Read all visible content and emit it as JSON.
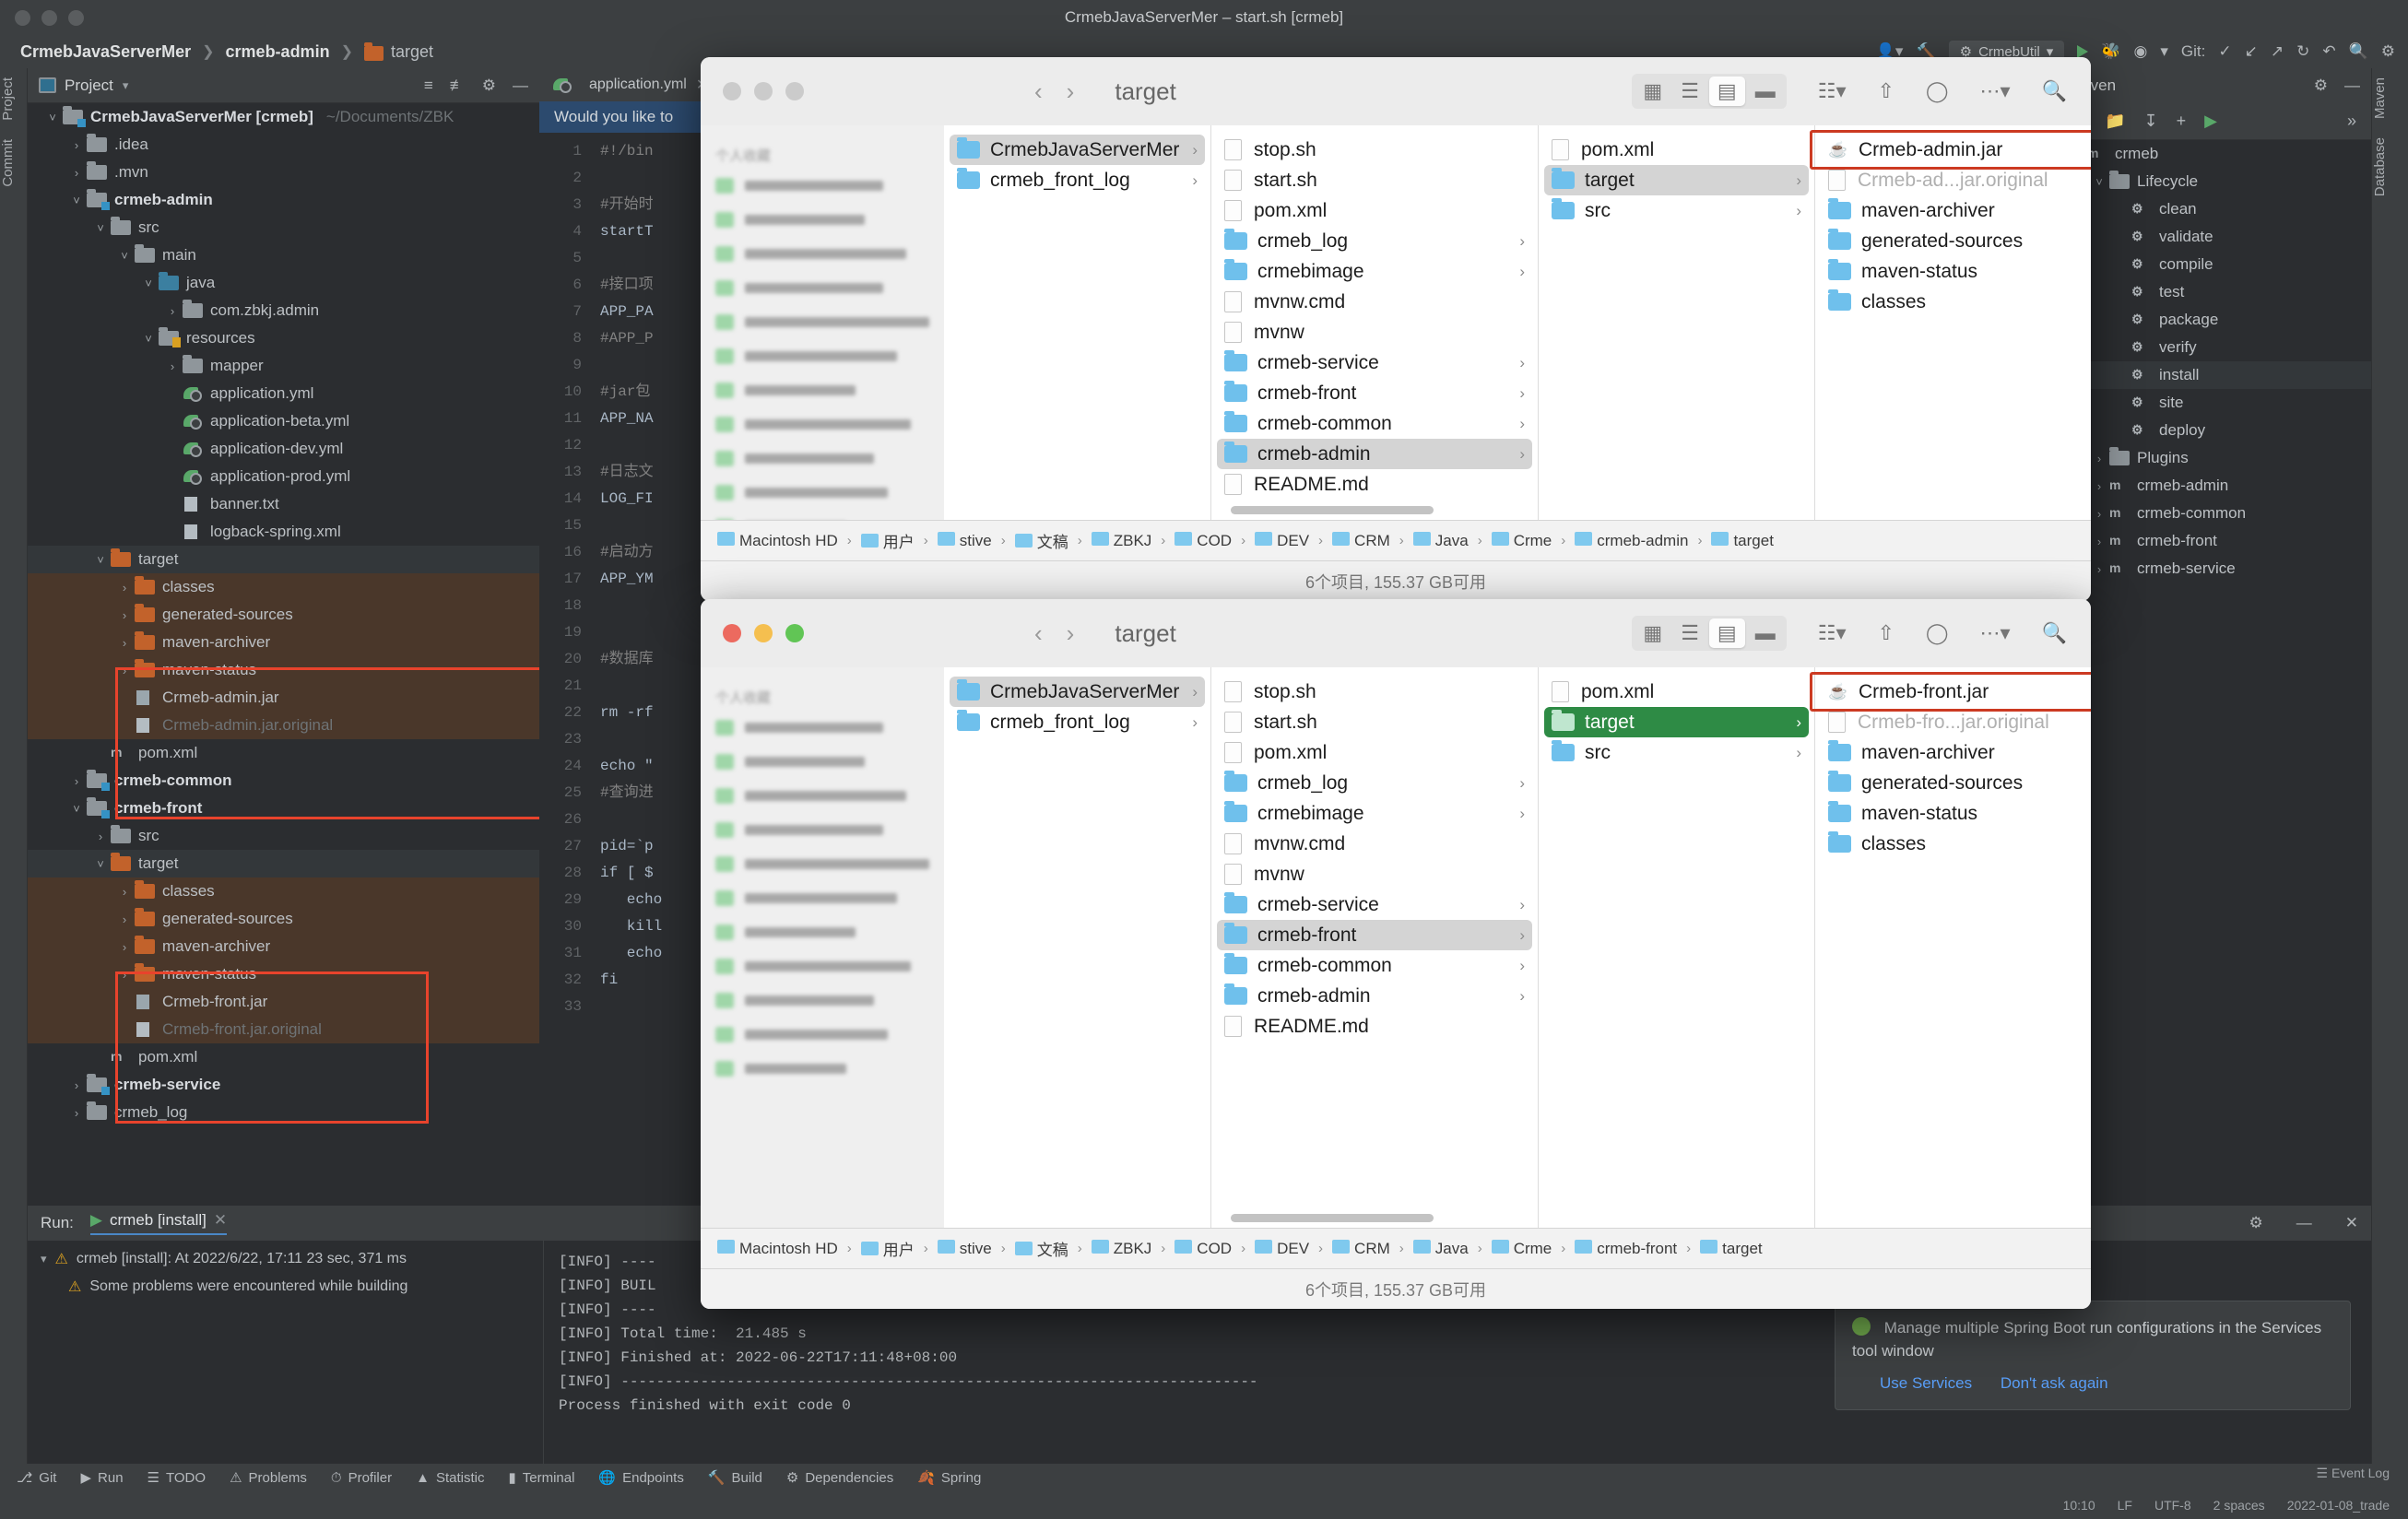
{
  "window": {
    "title": "CrmebJavaServerMer – start.sh [crmeb]",
    "traffic_lights": [
      "close",
      "minimize",
      "maximize"
    ]
  },
  "breadcrumb": {
    "project": "CrmebJavaServerMer",
    "module": "crmeb-admin",
    "folder": "target",
    "separator": "❯"
  },
  "toolbar": {
    "run_config": "CrmebUtil",
    "git_label": "Git:",
    "icons": [
      "run-icon",
      "hammer-icon",
      "debug-icon",
      "coverage-icon",
      "profile-icon",
      "dropdown-icon",
      "check-icon",
      "update-icon",
      "push-icon",
      "history-icon",
      "undo-icon",
      "search-icon",
      "settings-icon"
    ]
  },
  "left_stripe": [
    "Project",
    "Commit"
  ],
  "right_stripe": [
    "Maven",
    "Database"
  ],
  "project_panel": {
    "title": "Project",
    "tree": [
      {
        "depth": 0,
        "arrow": "v",
        "icon": "module",
        "label": "CrmebJavaServerMer [crmeb]",
        "suffix": "~/Documents/ZBK",
        "bold": true
      },
      {
        "depth": 1,
        "arrow": ">",
        "icon": "folder",
        "label": ".idea"
      },
      {
        "depth": 1,
        "arrow": ">",
        "icon": "folder",
        "label": ".mvn"
      },
      {
        "depth": 1,
        "arrow": "v",
        "icon": "module",
        "label": "crmeb-admin",
        "bold": true
      },
      {
        "depth": 2,
        "arrow": "v",
        "icon": "folder",
        "label": "src"
      },
      {
        "depth": 3,
        "arrow": "v",
        "icon": "folder",
        "label": "main"
      },
      {
        "depth": 4,
        "arrow": "v",
        "icon": "folder-blue",
        "label": "java"
      },
      {
        "depth": 5,
        "arrow": ">",
        "icon": "package",
        "label": "com.zbkj.admin"
      },
      {
        "depth": 4,
        "arrow": "v",
        "icon": "folder-res",
        "label": "resources"
      },
      {
        "depth": 5,
        "arrow": ">",
        "icon": "folder",
        "label": "mapper"
      },
      {
        "depth": 5,
        "arrow": "",
        "icon": "yml",
        "label": "application.yml"
      },
      {
        "depth": 5,
        "arrow": "",
        "icon": "yml",
        "label": "application-beta.yml"
      },
      {
        "depth": 5,
        "arrow": "",
        "icon": "yml",
        "label": "application-dev.yml"
      },
      {
        "depth": 5,
        "arrow": "",
        "icon": "yml",
        "label": "application-prod.yml"
      },
      {
        "depth": 5,
        "arrow": "",
        "icon": "txt",
        "label": "banner.txt"
      },
      {
        "depth": 5,
        "arrow": "",
        "icon": "xml",
        "label": "logback-spring.xml"
      },
      {
        "depth": 2,
        "arrow": "v",
        "icon": "folder-orange",
        "label": "target",
        "highlight": "header"
      },
      {
        "depth": 3,
        "arrow": ">",
        "icon": "folder-orange",
        "label": "classes",
        "highlight": "body"
      },
      {
        "depth": 3,
        "arrow": ">",
        "icon": "folder-orange",
        "label": "generated-sources",
        "highlight": "body"
      },
      {
        "depth": 3,
        "arrow": ">",
        "icon": "folder-orange",
        "label": "maven-archiver",
        "highlight": "body"
      },
      {
        "depth": 3,
        "arrow": ">",
        "icon": "folder-orange",
        "label": "maven-status",
        "highlight": "body"
      },
      {
        "depth": 3,
        "arrow": "",
        "icon": "jar",
        "label": "Crmeb-admin.jar",
        "highlight": "body"
      },
      {
        "depth": 3,
        "arrow": "",
        "icon": "file",
        "label": "Crmeb-admin.jar.original",
        "highlight": "body",
        "dim": true
      },
      {
        "depth": 2,
        "arrow": "",
        "icon": "maven",
        "label": "pom.xml"
      },
      {
        "depth": 1,
        "arrow": ">",
        "icon": "module",
        "label": "crmeb-common",
        "bold": true
      },
      {
        "depth": 1,
        "arrow": "v",
        "icon": "module",
        "label": "crmeb-front",
        "bold": true
      },
      {
        "depth": 2,
        "arrow": ">",
        "icon": "folder",
        "label": "src"
      },
      {
        "depth": 2,
        "arrow": "v",
        "icon": "folder-orange",
        "label": "target",
        "highlight": "header2"
      },
      {
        "depth": 3,
        "arrow": ">",
        "icon": "folder-orange",
        "label": "classes",
        "highlight": "body2"
      },
      {
        "depth": 3,
        "arrow": ">",
        "icon": "folder-orange",
        "label": "generated-sources",
        "highlight": "body2"
      },
      {
        "depth": 3,
        "arrow": ">",
        "icon": "folder-orange",
        "label": "maven-archiver",
        "highlight": "body2"
      },
      {
        "depth": 3,
        "arrow": ">",
        "icon": "folder-orange",
        "label": "maven-status",
        "highlight": "body2"
      },
      {
        "depth": 3,
        "arrow": "",
        "icon": "jar",
        "label": "Crmeb-front.jar",
        "highlight": "body2"
      },
      {
        "depth": 3,
        "arrow": "",
        "icon": "file",
        "label": "Crmeb-front.jar.original",
        "highlight": "body2",
        "dim": true
      },
      {
        "depth": 2,
        "arrow": "",
        "icon": "maven",
        "label": "pom.xml"
      },
      {
        "depth": 1,
        "arrow": ">",
        "icon": "module",
        "label": "crmeb-service",
        "bold": true
      },
      {
        "depth": 1,
        "arrow": ">",
        "icon": "folder",
        "label": "crmeb_log"
      }
    ]
  },
  "editor": {
    "tab": "application.yml",
    "notification": "Would you like to",
    "lines": [
      {
        "n": "1",
        "text": "#!/bin"
      },
      {
        "n": "2",
        "text": ""
      },
      {
        "n": "3",
        "text": "#开始时"
      },
      {
        "n": "4",
        "text": "startT"
      },
      {
        "n": "5",
        "text": ""
      },
      {
        "n": "6",
        "text": "#接口项"
      },
      {
        "n": "7",
        "text": "APP_PA"
      },
      {
        "n": "8",
        "text": "#APP_P"
      },
      {
        "n": "9",
        "text": ""
      },
      {
        "n": "10",
        "text": "#jar包"
      },
      {
        "n": "11",
        "text": "APP_NA"
      },
      {
        "n": "12",
        "text": ""
      },
      {
        "n": "13",
        "text": "#日志文"
      },
      {
        "n": "14",
        "text": "LOG_FI"
      },
      {
        "n": "15",
        "text": ""
      },
      {
        "n": "16",
        "text": "#启动方"
      },
      {
        "n": "17",
        "text": "APP_YM"
      },
      {
        "n": "18",
        "text": ""
      },
      {
        "n": "19",
        "text": ""
      },
      {
        "n": "20",
        "text": "#数据库"
      },
      {
        "n": "21",
        "text": ""
      },
      {
        "n": "22",
        "text": "rm -rf"
      },
      {
        "n": "23",
        "text": ""
      },
      {
        "n": "24",
        "text": "echo \""
      },
      {
        "n": "25",
        "text": "#查询进"
      },
      {
        "n": "26",
        "text": ""
      },
      {
        "n": "27",
        "text": "pid=`p"
      },
      {
        "n": "28",
        "text": "if [ $"
      },
      {
        "n": "29",
        "text": "   echo"
      },
      {
        "n": "30",
        "text": "   kill"
      },
      {
        "n": "31",
        "text": "   echo"
      },
      {
        "n": "32",
        "text": "fi"
      },
      {
        "n": "33",
        "text": ""
      }
    ]
  },
  "maven": {
    "title": "Maven",
    "tools": [
      "reload-icon",
      "reload-project-icon",
      "download-sources-icon",
      "add-icon",
      "run-icon",
      "more-icon"
    ],
    "tree": [
      {
        "depth": 0,
        "arrow": "v",
        "icon": "maven",
        "label": "crmeb"
      },
      {
        "depth": 1,
        "arrow": "v",
        "icon": "phase-folder",
        "label": "Lifecycle"
      },
      {
        "depth": 2,
        "arrow": "",
        "icon": "gear",
        "label": "clean"
      },
      {
        "depth": 2,
        "arrow": "",
        "icon": "gear",
        "label": "validate"
      },
      {
        "depth": 2,
        "arrow": "",
        "icon": "gear",
        "label": "compile"
      },
      {
        "depth": 2,
        "arrow": "",
        "icon": "gear",
        "label": "test"
      },
      {
        "depth": 2,
        "arrow": "",
        "icon": "gear",
        "label": "package"
      },
      {
        "depth": 2,
        "arrow": "",
        "icon": "gear",
        "label": "verify"
      },
      {
        "depth": 2,
        "arrow": "",
        "icon": "gear",
        "label": "install",
        "selected": true
      },
      {
        "depth": 2,
        "arrow": "",
        "icon": "gear",
        "label": "site"
      },
      {
        "depth": 2,
        "arrow": "",
        "icon": "gear",
        "label": "deploy"
      },
      {
        "depth": 1,
        "arrow": ">",
        "icon": "phase-folder",
        "label": "Plugins"
      },
      {
        "depth": 1,
        "arrow": ">",
        "icon": "maven",
        "label": "crmeb-admin"
      },
      {
        "depth": 1,
        "arrow": ">",
        "icon": "maven",
        "label": "crmeb-common"
      },
      {
        "depth": 1,
        "arrow": ">",
        "icon": "maven",
        "label": "crmeb-front"
      },
      {
        "depth": 1,
        "arrow": ">",
        "icon": "maven",
        "label": "crmeb-service"
      }
    ]
  },
  "run_panel": {
    "label": "Run:",
    "tab": "crmeb [install]",
    "tree_line": "crmeb [install]: At 2022/6/22, 17:11 23 sec, 371 ms",
    "warning": "Some problems were encountered while building",
    "console": [
      "[INFO] ----",
      "[INFO] BUIL",
      "[INFO] ----",
      "[INFO] Total time:  21.485 s",
      "[INFO] Finished at: 2022-06-22T17:11:48+08:00",
      "[INFO] ------------------------------------------------------------------------",
      "",
      "Process finished with exit code 0"
    ]
  },
  "bottom_toolbar": [
    {
      "label": "Git",
      "icon": "git-icon"
    },
    {
      "label": "Run",
      "icon": "run-icon"
    },
    {
      "label": "TODO",
      "icon": "todo-icon"
    },
    {
      "label": "Problems",
      "icon": "problems-icon"
    },
    {
      "label": "Profiler",
      "icon": "profiler-icon"
    },
    {
      "label": "Statistic",
      "icon": "statistic-icon"
    },
    {
      "label": "Terminal",
      "icon": "terminal-icon"
    },
    {
      "label": "Endpoints",
      "icon": "endpoints-icon"
    },
    {
      "label": "Build",
      "icon": "build-icon"
    },
    {
      "label": "Dependencies",
      "icon": "dependencies-icon"
    },
    {
      "label": "Spring",
      "icon": "spring-icon"
    }
  ],
  "status_bar": {
    "items": [
      "10:10",
      "LF",
      "UTF-8",
      "2 spaces",
      "2022-01-08_trade"
    ],
    "event_log": "Event Log"
  },
  "spring_notification": {
    "text": "Manage multiple Spring Boot run configurations in the Services tool window",
    "actions": [
      "Use Services",
      "Don't ask again"
    ]
  },
  "finder_windows": [
    {
      "id": "finder-admin",
      "title": "target",
      "toolbar_icons": [
        "grid-view-icon",
        "list-view-icon",
        "column-view-icon",
        "gallery-view-icon",
        "group-icon",
        "share-icon",
        "tag-icon",
        "more-icon",
        "search-icon"
      ],
      "active_view": "column-view-icon",
      "sidebar_header": "个人收藏",
      "columns": [
        {
          "items": [
            {
              "label": "CrmebJavaServerMer",
              "icon": "folder",
              "chevron": true,
              "state": "gray-selected"
            },
            {
              "label": "crmeb_front_log",
              "icon": "folder",
              "chevron": true
            }
          ]
        },
        {
          "items": [
            {
              "label": "stop.sh",
              "icon": "file"
            },
            {
              "label": "start.sh",
              "icon": "file"
            },
            {
              "label": "pom.xml",
              "icon": "file"
            },
            {
              "label": "crmeb_log",
              "icon": "folder",
              "chevron": true
            },
            {
              "label": "crmebimage",
              "icon": "folder",
              "chevron": true
            },
            {
              "label": "mvnw.cmd",
              "icon": "file"
            },
            {
              "label": "mvnw",
              "icon": "file"
            },
            {
              "label": "crmeb-service",
              "icon": "folder",
              "chevron": true
            },
            {
              "label": "crmeb-front",
              "icon": "folder",
              "chevron": true
            },
            {
              "label": "crmeb-common",
              "icon": "folder",
              "chevron": true
            },
            {
              "label": "crmeb-admin",
              "icon": "folder",
              "chevron": true,
              "state": "gray-selected"
            },
            {
              "label": "README.md",
              "icon": "file"
            }
          ]
        },
        {
          "items": [
            {
              "label": "pom.xml",
              "icon": "file"
            },
            {
              "label": "target",
              "icon": "folder",
              "chevron": true,
              "state": "gray-selected"
            },
            {
              "label": "src",
              "icon": "folder",
              "chevron": true
            }
          ]
        },
        {
          "items": [
            {
              "label": "Crmeb-admin.jar",
              "icon": "jar",
              "boxed": true
            },
            {
              "label": "Crmeb-ad...jar.original",
              "icon": "file",
              "grayed": true
            },
            {
              "label": "maven-archiver",
              "icon": "folder",
              "chevron": true
            },
            {
              "label": "generated-sources",
              "icon": "folder",
              "chevron": true
            },
            {
              "label": "maven-status",
              "icon": "folder",
              "chevron": true
            },
            {
              "label": "classes",
              "icon": "folder",
              "chevron": true
            }
          ]
        }
      ],
      "path_bar": [
        "Macintosh HD",
        "用户",
        "stive",
        "文稿",
        "ZBKJ",
        "COD",
        "DEV",
        "CRM",
        "Java",
        "Crme",
        "crmeb-admin",
        "target"
      ],
      "status": "6个项目, 155.37 GB可用"
    },
    {
      "id": "finder-front",
      "title": "target",
      "toolbar_icons": [
        "grid-view-icon",
        "list-view-icon",
        "column-view-icon",
        "gallery-view-icon",
        "group-icon",
        "share-icon",
        "tag-icon",
        "more-icon",
        "search-icon"
      ],
      "active_view": "column-view-icon",
      "sidebar_header": "个人收藏",
      "columns": [
        {
          "items": [
            {
              "label": "CrmebJavaServerMer",
              "icon": "folder",
              "chevron": true,
              "state": "gray-selected"
            },
            {
              "label": "crmeb_front_log",
              "icon": "folder",
              "chevron": true
            }
          ]
        },
        {
          "items": [
            {
              "label": "stop.sh",
              "icon": "file"
            },
            {
              "label": "start.sh",
              "icon": "file"
            },
            {
              "label": "pom.xml",
              "icon": "file"
            },
            {
              "label": "crmeb_log",
              "icon": "folder",
              "chevron": true
            },
            {
              "label": "crmebimage",
              "icon": "folder",
              "chevron": true
            },
            {
              "label": "mvnw.cmd",
              "icon": "file"
            },
            {
              "label": "mvnw",
              "icon": "file"
            },
            {
              "label": "crmeb-service",
              "icon": "folder",
              "chevron": true
            },
            {
              "label": "crmeb-front",
              "icon": "folder",
              "chevron": true,
              "state": "gray-selected"
            },
            {
              "label": "crmeb-common",
              "icon": "folder",
              "chevron": true
            },
            {
              "label": "crmeb-admin",
              "icon": "folder",
              "chevron": true
            },
            {
              "label": "README.md",
              "icon": "file"
            }
          ]
        },
        {
          "items": [
            {
              "label": "pom.xml",
              "icon": "file"
            },
            {
              "label": "target",
              "icon": "folder",
              "chevron": true,
              "state": "blue-selected"
            },
            {
              "label": "src",
              "icon": "folder",
              "chevron": true
            }
          ]
        },
        {
          "items": [
            {
              "label": "Crmeb-front.jar",
              "icon": "jar",
              "boxed": true
            },
            {
              "label": "Crmeb-fro...jar.original",
              "icon": "file",
              "grayed": true
            },
            {
              "label": "maven-archiver",
              "icon": "folder",
              "chevron": true
            },
            {
              "label": "generated-sources",
              "icon": "folder",
              "chevron": true
            },
            {
              "label": "maven-status",
              "icon": "folder",
              "chevron": true
            },
            {
              "label": "classes",
              "icon": "folder",
              "chevron": true
            }
          ]
        }
      ],
      "path_bar": [
        "Macintosh HD",
        "用户",
        "stive",
        "文稿",
        "ZBKJ",
        "COD",
        "DEV",
        "CRM",
        "Java",
        "Crme",
        "crmeb-front",
        "target"
      ],
      "status": "6个项目, 155.37 GB可用"
    }
  ],
  "colors": {
    "accent_blue": "#4a88c7",
    "folder_orange": "#c2622b",
    "highlight_red": "#e8432c",
    "finder_red": "#cc3a22",
    "finder_blue": "#6fc0ec",
    "finder_green": "#2e8b45",
    "ide_bg": "#2b2d30",
    "panel_bg": "#3c3f41"
  }
}
